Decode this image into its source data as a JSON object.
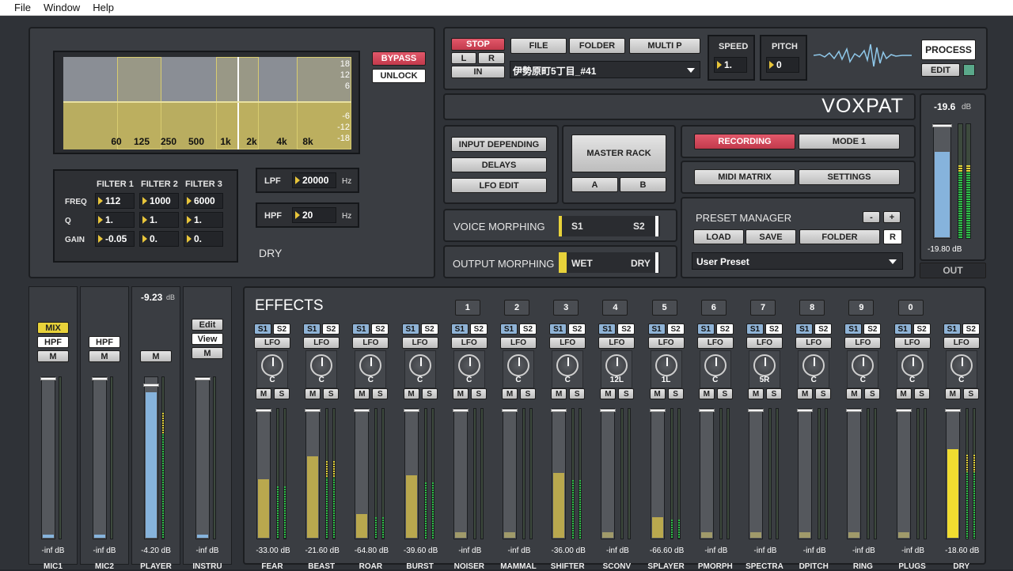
{
  "menu": {
    "file": "File",
    "window": "Window",
    "help": "Help"
  },
  "eq": {
    "bypass": "BYPASS",
    "unlock": "UNLOCK",
    "freq_labels": [
      "60",
      "125",
      "250",
      "500",
      "1k",
      "2k",
      "4k",
      "8k"
    ],
    "db_labels": [
      "18",
      "12",
      "6",
      "-6",
      "-12",
      "-18"
    ],
    "filters": {
      "headers": [
        "FILTER 1",
        "FILTER 2",
        "FILTER 3"
      ],
      "row_labels": [
        "FREQ",
        "Q",
        "GAIN"
      ],
      "values": [
        [
          "112",
          "1000",
          "6000"
        ],
        [
          "1.",
          "1.",
          "1."
        ],
        [
          "-0.05",
          "0.",
          "0."
        ]
      ]
    },
    "lpf": {
      "label": "LPF",
      "value": "20000",
      "unit": "Hz"
    },
    "hpf": {
      "label": "HPF",
      "value": "20",
      "unit": "Hz"
    },
    "dry": "DRY"
  },
  "transport": {
    "stop": "STOP",
    "l": "L",
    "r": "R",
    "in": "IN",
    "file": "FILE",
    "folder": "FOLDER",
    "multi": "MULTI P",
    "file_name": "伊勢原町5丁目_#41",
    "speed_label": "SPEED",
    "speed": "1.",
    "pitch_label": "PITCH",
    "pitch": "0",
    "process": "PROCESS",
    "edit": "EDIT"
  },
  "brand": "VOXPAT",
  "routing": {
    "input_depending": "INPUT DEPENDING",
    "delays": "DELAYS",
    "lfo_edit": "LFO EDIT",
    "master_rack": "MASTER RACK",
    "a": "A",
    "b": "B"
  },
  "rec": {
    "recording": "RECORDING",
    "mode": "MODE 1",
    "midi": "MIDI MATRIX",
    "settings": "SETTINGS"
  },
  "voice": {
    "label": "VOICE MORPHING",
    "s1": "S1",
    "s2": "S2"
  },
  "output": {
    "label": "OUTPUT MORPHING",
    "wet": "WET",
    "dry": "DRY"
  },
  "preset": {
    "title": "PRESET MANAGER",
    "minus": "-",
    "plus": "+",
    "load": "LOAD",
    "save": "SAVE",
    "folder": "FOLDER",
    "r": "R",
    "current": "User Preset"
  },
  "out": {
    "db": "-19.6",
    "unit": "dB",
    "peak": "-19.80 dB",
    "label": "OUT"
  },
  "inputs": [
    {
      "name": "MIC1",
      "db": "-inf dB",
      "buttons": [
        "MIX",
        "HPF",
        "M"
      ]
    },
    {
      "name": "MIC2",
      "db": "-inf dB",
      "buttons": [
        "HPF",
        "M"
      ]
    },
    {
      "name": "PLAYER",
      "db": "-4.20 dB",
      "top": "-9.23",
      "top_unit": "dB",
      "buttons": [
        "M"
      ]
    },
    {
      "name": "INSTRU",
      "db": "-inf dB",
      "buttons": [
        "Edit",
        "View",
        "M"
      ]
    }
  ],
  "effects": {
    "title": "EFFECTS",
    "s1": "S1",
    "s2": "S2",
    "lfo": "LFO",
    "m": "M",
    "s": "S",
    "channels": [
      {
        "name": "FEAR",
        "num": "",
        "knob": "C",
        "db": "-33.00 dB",
        "level": 0.45
      },
      {
        "name": "BEAST",
        "num": "",
        "knob": "C",
        "db": "-21.60 dB",
        "level": 0.63
      },
      {
        "name": "ROAR",
        "num": "",
        "knob": "C",
        "db": "-64.80 dB",
        "level": 0.18
      },
      {
        "name": "BURST",
        "num": "",
        "knob": "C",
        "db": "-39.60 dB",
        "level": 0.48
      },
      {
        "name": "NOISER",
        "num": "1",
        "knob": "C",
        "db": "-inf dB",
        "level": 0
      },
      {
        "name": "MAMMAL",
        "num": "2",
        "knob": "C",
        "db": "-inf dB",
        "level": 0
      },
      {
        "name": "SHIFTER",
        "num": "3",
        "knob": "C",
        "db": "-36.00 dB",
        "level": 0.5
      },
      {
        "name": "SCONV",
        "num": "4",
        "knob": "12L",
        "db": "-inf dB",
        "level": 0
      },
      {
        "name": "SPLAYER",
        "num": "5",
        "knob": "1L",
        "db": "-66.60 dB",
        "level": 0.16
      },
      {
        "name": "PMORPH",
        "num": "6",
        "knob": "C",
        "db": "-inf dB",
        "level": 0
      },
      {
        "name": "SPECTRA",
        "num": "7",
        "knob": "5R",
        "db": "-inf dB",
        "level": 0
      },
      {
        "name": "DPITCH",
        "num": "8",
        "knob": "C",
        "db": "-inf dB",
        "level": 0
      },
      {
        "name": "RING",
        "num": "9",
        "knob": "C",
        "db": "-inf dB",
        "level": 0
      },
      {
        "name": "PLUGS",
        "num": "0",
        "knob": "C",
        "db": "-inf dB",
        "level": 0
      },
      {
        "name": "DRY",
        "num": "",
        "knob": "C",
        "db": "-18.60 dB",
        "level": 0.68
      }
    ]
  },
  "colors": {
    "accent_red": "#d64a5c",
    "fader_gold": "#b9a84e",
    "fader_blue": "#86b3dc",
    "fader_yellow": "#f0dc30",
    "meter_green": "#2fc04a"
  }
}
